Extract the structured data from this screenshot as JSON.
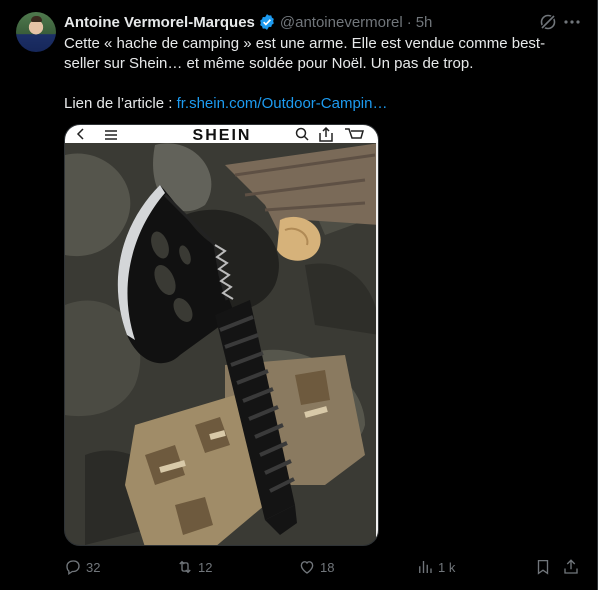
{
  "tweet": {
    "author_name": "Antoine Vermorel-Marques",
    "handle": "@antoinevermorel",
    "separator": "·",
    "time": "5h",
    "text_line1": "Cette « hache de camping » est une arme. Elle est vendue comme best-seller sur Shein… et même soldée pour Noël. Un pas de trop.",
    "link_prefix": "Lien de l’article : ",
    "link_text": "fr.shein.com/Outdoor-Campin…"
  },
  "media": {
    "brand": "SHEIN"
  },
  "actions": {
    "replies": "32",
    "reposts": "12",
    "likes": "18",
    "views": "1 k"
  },
  "colors": {
    "background": "#000000",
    "text": "#e7e9ea",
    "muted": "#71767b",
    "link": "#1d9bf0",
    "verified": "#1d9bf0"
  }
}
